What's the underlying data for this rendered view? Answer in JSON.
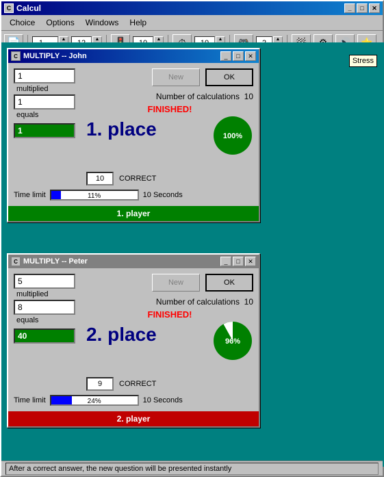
{
  "window": {
    "title": "Calcul",
    "menu": [
      "Choice",
      "Options",
      "Windows",
      "Help"
    ]
  },
  "toolbar": {
    "spinner1_value": "1....",
    "spinner2_value": "12",
    "spinner3_value": "10",
    "spinner4_value": "10",
    "spinner5_value": "2"
  },
  "stress_tooltip": "Stress",
  "player1": {
    "title": "MULTIPLY  --  John",
    "btn_new": "New",
    "btn_ok": "OK",
    "number1": "1",
    "label_multiplied": "multiplied",
    "number2": "1",
    "label_equals": "equals",
    "answer": "1",
    "place_text": "1. place",
    "num_calculations_label": "Number of calculations",
    "num_calculations": "10",
    "finished": "FINISHED!",
    "correct_value": "10",
    "correct_label": "CORRECT",
    "time_label": "Time limit",
    "time_pct": "11%",
    "time_pct_num": 11,
    "time_seconds": "10 Seconds",
    "pie_pct": "100%",
    "pie_pct_num": 100,
    "bar_label": "1. player"
  },
  "player2": {
    "title": "MULTIPLY  --  Peter",
    "btn_new": "New",
    "btn_ok": "OK",
    "number1": "5",
    "label_multiplied": "multiplied",
    "number2": "8",
    "label_equals": "equals",
    "answer": "40",
    "place_text": "2. place",
    "num_calculations_label": "Number of calculations",
    "num_calculations": "10",
    "finished": "FINISHED!",
    "correct_value": "9",
    "correct_label": "CORRECT",
    "time_label": "Time limit",
    "time_pct": "24%",
    "time_pct_num": 24,
    "time_seconds": "10 Seconds",
    "pie_pct": "96%",
    "pie_pct_num": 96,
    "bar_label": "2. player"
  },
  "status": {
    "text": "After a correct answer, the new question will be presented instantly"
  }
}
